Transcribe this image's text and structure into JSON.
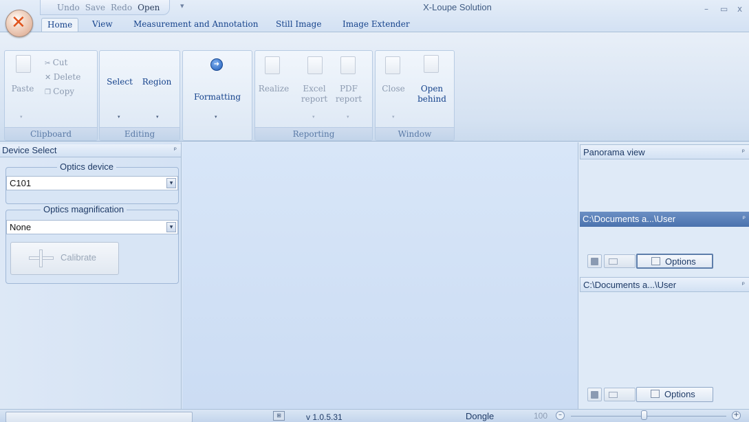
{
  "title_bar": {
    "title": "X-Loupe Solution",
    "quick_access": {
      "undo": "Undo",
      "save": "Save",
      "redo": "Redo",
      "open": "Open",
      "more": "▾"
    },
    "window_controls": {
      "minimize": "–",
      "maximize": "▭",
      "close": "x"
    }
  },
  "tabs": [
    {
      "label": "Home",
      "active": true
    },
    {
      "label": "View"
    },
    {
      "label": "Measurement and Annotation"
    },
    {
      "label": "Still Image"
    },
    {
      "label": "Image Extender"
    }
  ],
  "ribbon": {
    "clipboard": {
      "label": "Clipboard",
      "paste": "Paste",
      "cut": "Cut",
      "delete": "Delete",
      "copy": "Copy"
    },
    "editing": {
      "label": "Editing",
      "select": "Select",
      "region": "Region"
    },
    "formatting": {
      "label": "Formatting"
    },
    "reporting": {
      "label": "Reporting",
      "realize": "Realize",
      "excel_1": "Excel",
      "excel_2": "report",
      "pdf_1": "PDF",
      "pdf_2": "report"
    },
    "window": {
      "label": "Window",
      "close": "Close",
      "open_behind_1": "Open",
      "open_behind_2": "behind"
    },
    "icons": [
      "paste-icon",
      "cut-icon",
      "delete-icon",
      "copy-icon",
      "formatting-icon",
      "realize-icon",
      "excel-report-icon",
      "pdf-report-icon",
      "close-window-icon",
      "open-behind-icon"
    ],
    "dropdown_arrow": "▾"
  },
  "device_select": {
    "title": "Device Select",
    "pin": "ᵖ",
    "optics_device": {
      "legend": "Optics device",
      "value": "C101"
    },
    "optics_magnification": {
      "legend": "Optics magnification",
      "value": "None"
    },
    "calibrate": "Calibrate",
    "combo_arrow": "▼"
  },
  "right_panel": {
    "panorama": {
      "title": "Panorama view"
    },
    "pane1": {
      "title": "C:\\Documents a...\\User",
      "options": "Options"
    },
    "pane2": {
      "title": "C:\\Documents a...\\User",
      "options": "Options"
    }
  },
  "status_bar": {
    "version": "v 1.0.5.31",
    "dongle": "Dongle",
    "zoom": {
      "value": "100",
      "minus": "–",
      "plus": "+"
    },
    "zoom_level": 0.47
  },
  "colors": {
    "accent": "#15428b",
    "selected_pane": "#4a72ad",
    "orb": "#e0541d"
  }
}
